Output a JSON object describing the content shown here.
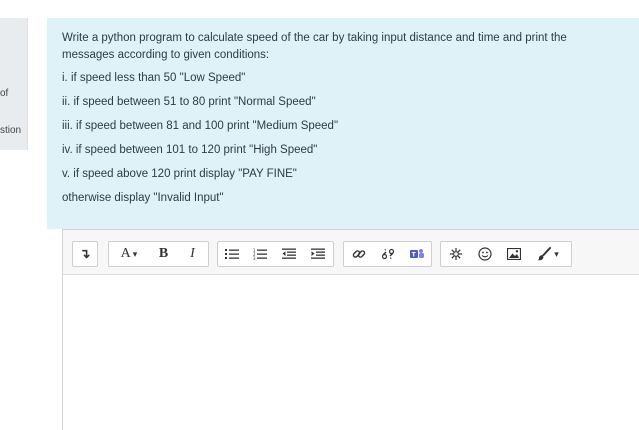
{
  "sidebar": {
    "fragment_1": "of",
    "fragment_2": "stion"
  },
  "question": {
    "intro": "Write a python program to calculate speed of the car by taking input distance and time and print the messages according to given conditions:",
    "conditions": [
      "i. if speed less than 50 \"Low Speed\"",
      "ii. if speed between 51 to 80 print \"Normal Speed\"",
      "iii. if speed between 81 and 100 print \"Medium Speed\"",
      "iv. if speed between 101 to 120 print \"High Speed\"",
      "v. if speed above 120 print display \"PAY FINE\""
    ],
    "otherwise": "otherwise display \"Invalid Input\""
  },
  "toolbar": {
    "paragraph_glyph": "↴",
    "font_glyph": "A",
    "dropdown_glyph": "▾",
    "bold_label": "B",
    "italic_label": "I"
  },
  "editor": {
    "content": ""
  },
  "colors": {
    "question_bg": "#def2f8",
    "toolbar_bg": "#f7f7f7",
    "teams_icon": "#5059c9"
  }
}
